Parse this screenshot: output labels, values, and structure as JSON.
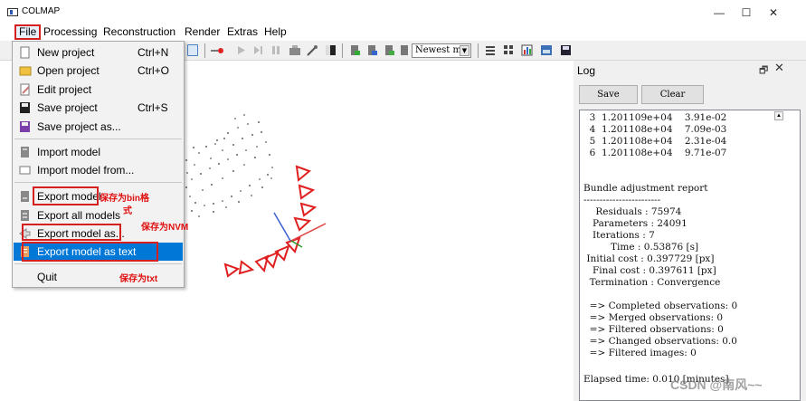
{
  "window": {
    "title": "COLMAP",
    "controls": {
      "minimize": "—",
      "maximize": "☐",
      "close": "✕"
    }
  },
  "menubar": {
    "items": [
      "File",
      "Processing",
      "Reconstruction",
      "Render",
      "Extras",
      "Help"
    ]
  },
  "toolbar": {
    "combo_value": "Newest m",
    "combo_arrow": "▼"
  },
  "file_menu": {
    "items": [
      {
        "label": "New project",
        "shortcut": "Ctrl+N",
        "icon": "new-file-icon"
      },
      {
        "label": "Open project",
        "shortcut": "Ctrl+O",
        "icon": "folder-open-icon"
      },
      {
        "label": "Edit project",
        "shortcut": "",
        "icon": "edit-icon"
      },
      {
        "label": "Save project",
        "shortcut": "Ctrl+S",
        "icon": "save-icon"
      },
      {
        "label": "Save project as...",
        "shortcut": "",
        "icon": "save-as-icon"
      },
      {
        "label": "Import model",
        "shortcut": "",
        "icon": "import-icon"
      },
      {
        "label": "Import model from...",
        "shortcut": "",
        "icon": "import-from-icon"
      },
      {
        "label": "Export model",
        "shortcut": "",
        "icon": "export-icon"
      },
      {
        "label": "Export all models",
        "shortcut": "",
        "icon": "export-all-icon"
      },
      {
        "label": "Export model as...",
        "shortcut": "",
        "icon": "export-as-icon"
      },
      {
        "label": "Export model as text",
        "shortcut": "",
        "icon": "export-text-icon",
        "selected": true
      },
      {
        "label": "Quit",
        "shortcut": "",
        "icon": ""
      }
    ]
  },
  "annotations": {
    "bin_part1": "保存为bin格",
    "bin_part2": "式",
    "nvm": "保存为NVM",
    "txt": "保存为txt"
  },
  "log": {
    "title": "Log",
    "float_icon": "🗗",
    "close_icon": "✕",
    "save_label": "Save",
    "clear_label": "Clear",
    "lines": [
      "  3  1.201109e+04    3.91e-02",
      "  4  1.201108e+04    7.09e-03",
      "  5  1.201108e+04    2.31e-04",
      "  6  1.201108e+04    9.71e-07",
      "",
      "",
      "Bundle adjustment report",
      "------------------------",
      "    Residuals : 75974",
      "   Parameters : 24091",
      "   Iterations : 7",
      "         Time : 0.53876 [s]",
      " Initial cost : 0.397729 [px]",
      "   Final cost : 0.397611 [px]",
      "  Termination : Convergence",
      "",
      "  => Completed observations: 0",
      "  => Merged observations: 0",
      "  => Filtered observations: 0",
      "  => Changed observations: 0.0",
      "  => Filtered images: 0",
      "",
      "Elapsed time: 0.010 [minutes]"
    ]
  },
  "watermark": "CSDN @南风~~",
  "colors": {
    "highlight": "#0078d7",
    "annotation_red": "#d62020",
    "camera_red": "#e02020"
  }
}
